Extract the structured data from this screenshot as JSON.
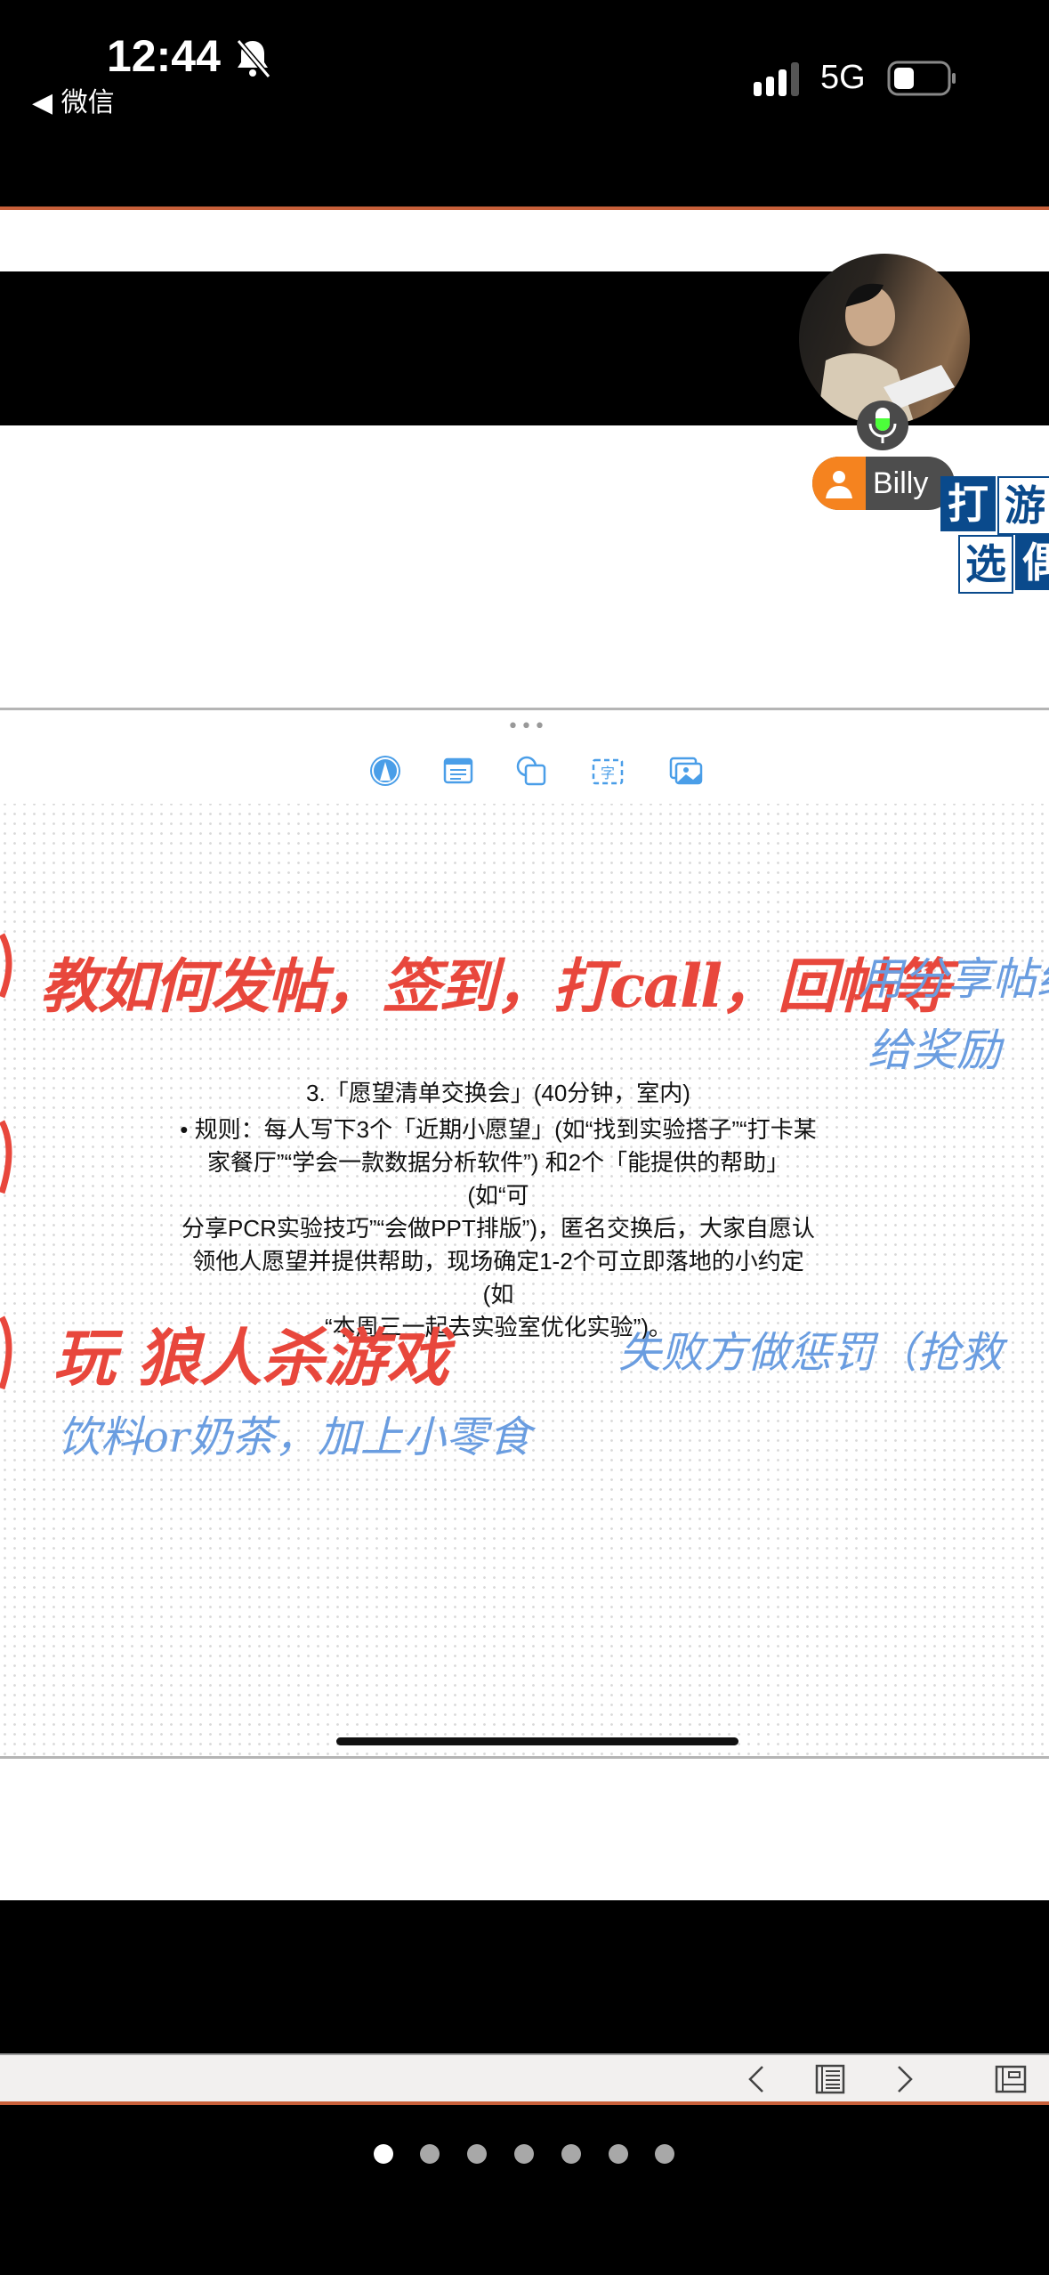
{
  "status_bar": {
    "time": "12:44",
    "back_app": "◀ 微信",
    "network": "5G",
    "icons": [
      "bell-slash-icon",
      "signal-icon",
      "battery-icon"
    ]
  },
  "participant": {
    "name": "Billy",
    "mic_state": "active",
    "colors": {
      "badge": "#f5831f",
      "mic": "#4cff3a"
    }
  },
  "logo": {
    "chars": [
      "打",
      "游",
      "选",
      "偶"
    ]
  },
  "whiteboard_toolbar": {
    "tools": [
      "pen-icon",
      "note-icon",
      "shapes-icon",
      "text-icon",
      "image-icon"
    ],
    "accent": "#4a9ee8"
  },
  "handwriting": {
    "line1_red": "教如何发帖，签到，打call，回帖等",
    "line1_blue_a": "用分享帖给",
    "line1_blue_b": "给奖励",
    "line3_red": "玩 狼人杀游戏",
    "line3_blue": "失败方做惩罚（抢救",
    "line4_blue": "饮料or奶茶，加上小零食"
  },
  "document": {
    "title": "3.「愿望清单交换会」(40分钟，室内)",
    "lines": [
      "• 规则：每人写下3个「近期小愿望」(如“找到实验搭子”“打卡某",
      "家餐厅”“学会一款数据分析软件”) 和2个「能提供的帮助」(如“可",
      "分享PCR实验技巧”“会做PPT排版”)，匿名交换后，大家自愿认",
      "领他人愿望并提供帮助，现场确定1-2个可立即落地的小约定 (如",
      "“本周三一起去实验室优化实验”)。"
    ]
  },
  "bottom_toolbar": {
    "buttons": [
      "previous-icon",
      "slides-list-icon",
      "next-icon",
      "layout-icon"
    ]
  },
  "pager": {
    "total": 7,
    "current": 1
  }
}
